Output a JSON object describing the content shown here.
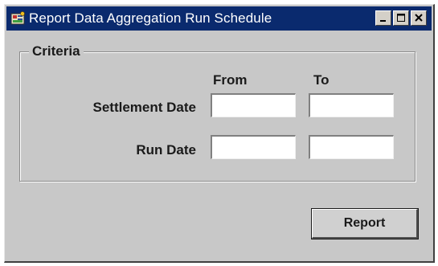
{
  "window": {
    "title": "Report Data Aggregation Run Schedule",
    "app_icon": "form-app-icon",
    "controls": {
      "minimize_icon": "minimize-icon",
      "maximize_icon": "maximize-icon",
      "close_icon": "close-icon"
    }
  },
  "criteria": {
    "legend": "Criteria",
    "columns": {
      "from": "From",
      "to": "To"
    },
    "rows": [
      {
        "label": "Settlement Date",
        "from_value": "",
        "to_value": ""
      },
      {
        "label": "Run Date",
        "from_value": "",
        "to_value": ""
      }
    ]
  },
  "actions": {
    "report_label": "Report"
  },
  "colors": {
    "titlebar": "#0a2a6e",
    "window_bg": "#c8c8c8",
    "field_bg": "#ffffff"
  }
}
